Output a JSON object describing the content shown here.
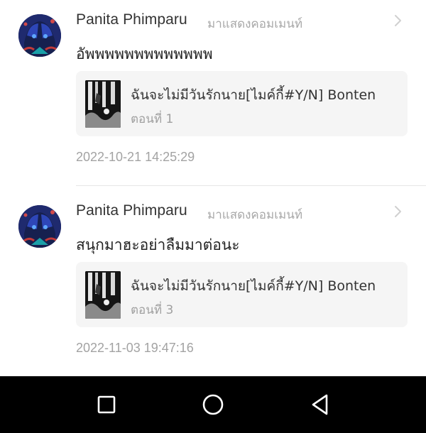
{
  "comments": [
    {
      "username": "Panita Phimparu",
      "action": "มาแสดงคอมเมนท์",
      "text": "อัพพพพพพพพพพพพพ",
      "card": {
        "title": "ฉันจะไม่มีวันรักนาย[ไมค์กี้#Y/N] Bonten",
        "episode": "ตอนที่ 1"
      },
      "timestamp": "2022-10-21 14:25:29"
    },
    {
      "username": "Panita Phimparu",
      "action": "มาแสดงคอมเมนท์",
      "text": "สนุกมาฮะอย่าลืมมาต่อนะ",
      "card": {
        "title": "ฉันจะไม่มีวันรักนาย[ไมค์กี้#Y/N] Bonten",
        "episode": "ตอนที่ 3"
      },
      "timestamp": "2022-11-03 19:47:16"
    }
  ],
  "navbar": {
    "items": [
      "recent-apps-icon",
      "home-icon",
      "back-icon"
    ]
  },
  "colors": {
    "username": "#333333",
    "secondary_text": "#a3a3a3",
    "card_background": "#f5f5f5",
    "navbar_background": "#000000"
  }
}
